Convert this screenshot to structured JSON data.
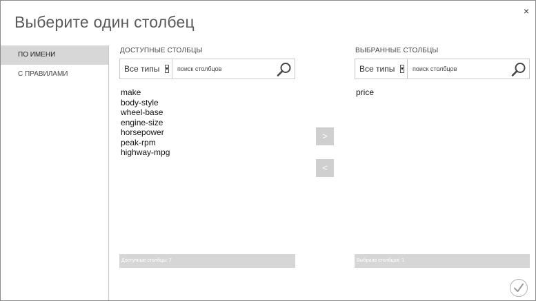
{
  "dialog": {
    "title": "Выберите один столбец",
    "close_glyph": "×"
  },
  "sidebar": {
    "items": [
      {
        "label": "ПО ИМЕНИ",
        "active": true
      },
      {
        "label": "С ПРАВИЛАМИ",
        "active": false
      }
    ]
  },
  "available": {
    "title": "ДОСТУПНЫЕ СТОЛБЦЫ",
    "type_filter": "Все типы",
    "search_placeholder": "поиск столбцов",
    "columns": [
      "make",
      "body-style",
      "wheel-base",
      "engine-size",
      "horsepower",
      "peak-rpm",
      "highway-mpg"
    ],
    "footer": "Доступные столбцы: 7"
  },
  "selected": {
    "title": "ВЫБРАННЫЕ СТОЛБЦЫ",
    "type_filter": "Все типы",
    "search_placeholder": "поиск столбцов",
    "columns": [
      "price"
    ],
    "footer": "Выбрано столбцов: 1"
  },
  "buttons": {
    "add_label": ">",
    "remove_label": "<"
  },
  "icons": {
    "search": "search-icon",
    "ok": "checkmark-icon",
    "close": "close-icon"
  },
  "colors": {
    "sidebar_active": "#d7d7d7",
    "button_gray": "#cfcfcf",
    "footer_gray": "#d6d6d6"
  }
}
